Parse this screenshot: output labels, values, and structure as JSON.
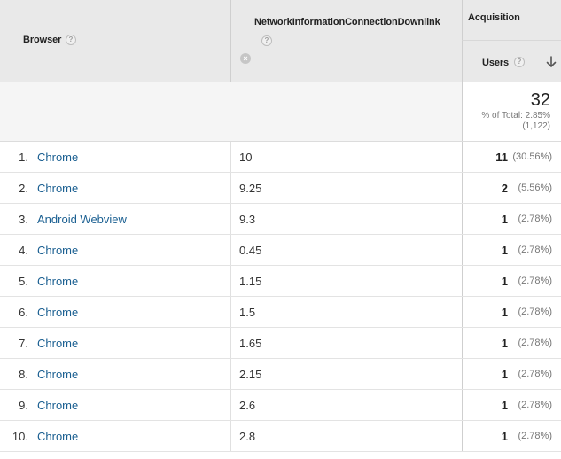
{
  "header": {
    "browser_label": "Browser",
    "network_label": "NetworkInformationConnectionDownlink",
    "acquisition_label": "Acquisition",
    "users_label": "Users",
    "help_glyph": "?",
    "remove_glyph": "×"
  },
  "summary": {
    "users_total": "32",
    "pct_of_total": "% of Total: 2.85%",
    "total_count": "(1,122)"
  },
  "rows": [
    {
      "index": "1.",
      "browser": "Chrome",
      "downlink": "10",
      "users": "11",
      "users_pct": "(30.56%)"
    },
    {
      "index": "2.",
      "browser": "Chrome",
      "downlink": "9.25",
      "users": "2",
      "users_pct": "(5.56%)"
    },
    {
      "index": "3.",
      "browser": "Android Webview",
      "downlink": "9.3",
      "users": "1",
      "users_pct": "(2.78%)"
    },
    {
      "index": "4.",
      "browser": "Chrome",
      "downlink": "0.45",
      "users": "1",
      "users_pct": "(2.78%)"
    },
    {
      "index": "5.",
      "browser": "Chrome",
      "downlink": "1.15",
      "users": "1",
      "users_pct": "(2.78%)"
    },
    {
      "index": "6.",
      "browser": "Chrome",
      "downlink": "1.5",
      "users": "1",
      "users_pct": "(2.78%)"
    },
    {
      "index": "7.",
      "browser": "Chrome",
      "downlink": "1.65",
      "users": "1",
      "users_pct": "(2.78%)"
    },
    {
      "index": "8.",
      "browser": "Chrome",
      "downlink": "2.15",
      "users": "1",
      "users_pct": "(2.78%)"
    },
    {
      "index": "9.",
      "browser": "Chrome",
      "downlink": "2.6",
      "users": "1",
      "users_pct": "(2.78%)"
    },
    {
      "index": "10.",
      "browser": "Chrome",
      "downlink": "2.8",
      "users": "1",
      "users_pct": "(2.78%)"
    }
  ],
  "colors": {
    "link": "#1a5f91",
    "header_bg": "#e9e9e9"
  },
  "icons": {
    "help": "help-icon",
    "remove_dimension": "remove-dimension-icon",
    "sort": "sort-descending-icon"
  }
}
